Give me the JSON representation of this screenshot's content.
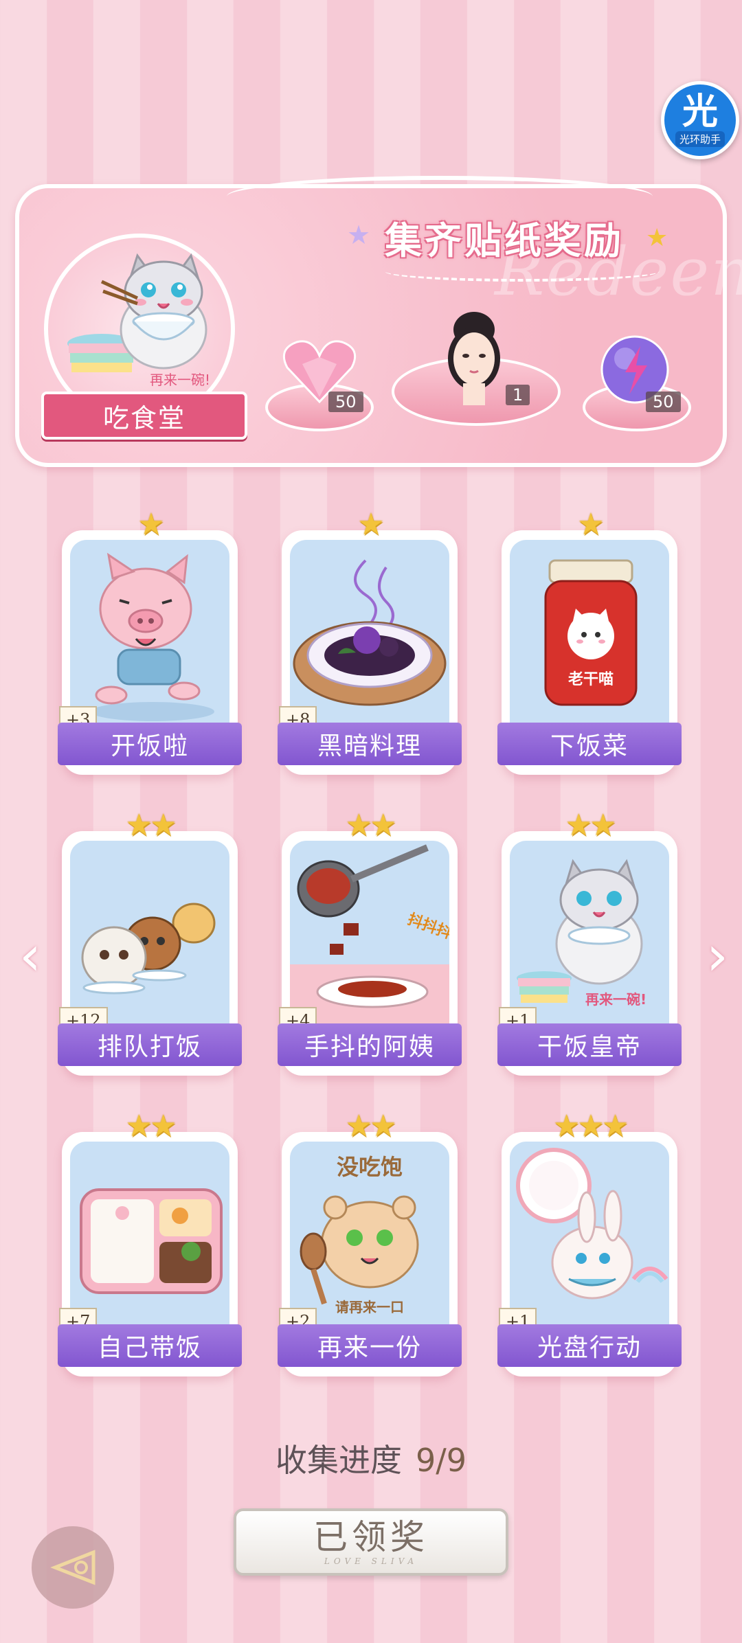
{
  "helper": {
    "glyph": "光",
    "label": "光环助手"
  },
  "reward": {
    "title": "集齐贴纸奖励",
    "watermark": "Redeem",
    "set_name": "吃食堂",
    "set_banner": "再来一碗!",
    "items": [
      {
        "icon": "pink-heart-gem-icon",
        "count": "50"
      },
      {
        "icon": "girl-portrait-icon",
        "count": "1"
      },
      {
        "icon": "purple-energy-orb-icon",
        "count": "50"
      }
    ]
  },
  "stickers": [
    {
      "name": "开饭啦",
      "bonus": "+3",
      "stars": "★",
      "icon": "pig-running-icon"
    },
    {
      "name": "黑暗料理",
      "bonus": "+8",
      "stars": "★",
      "icon": "dark-cuisine-plate-icon"
    },
    {
      "name": "下饭菜",
      "bonus": "",
      "stars": "★",
      "icon": "chili-sauce-jar-icon",
      "jar_label": "老干喵"
    },
    {
      "name": "排队打饭",
      "bonus": "+12",
      "stars": "★★",
      "icon": "queue-animals-icon"
    },
    {
      "name": "手抖的阿姨",
      "bonus": "+4",
      "stars": "★★",
      "icon": "shaking-ladle-icon",
      "caption": "抖抖抖!"
    },
    {
      "name": "干饭皇帝",
      "bonus": "+1",
      "stars": "★★",
      "icon": "cat-eating-rice-icon",
      "caption": "再来一碗!"
    },
    {
      "name": "自己带饭",
      "bonus": "+7",
      "stars": "★★",
      "icon": "bento-box-icon"
    },
    {
      "name": "再来一份",
      "bonus": "+2",
      "stars": "★★",
      "icon": "hamster-spoon-icon",
      "caption_top": "没吃饱",
      "caption_bottom": "请再来一口"
    },
    {
      "name": "光盘行动",
      "bonus": "+1",
      "stars": "★★★",
      "icon": "bunny-clean-plate-icon"
    }
  ],
  "progress": {
    "label": "收集进度",
    "value": "9/9"
  },
  "claim": {
    "label": "已领奖",
    "sub": "LOVE SLIVA"
  },
  "colors": {
    "accent_pink": "#e2587e",
    "card_purple": "#8256d0",
    "star_gold": "#f3c33a",
    "helper_blue": "#1e7fe0"
  }
}
